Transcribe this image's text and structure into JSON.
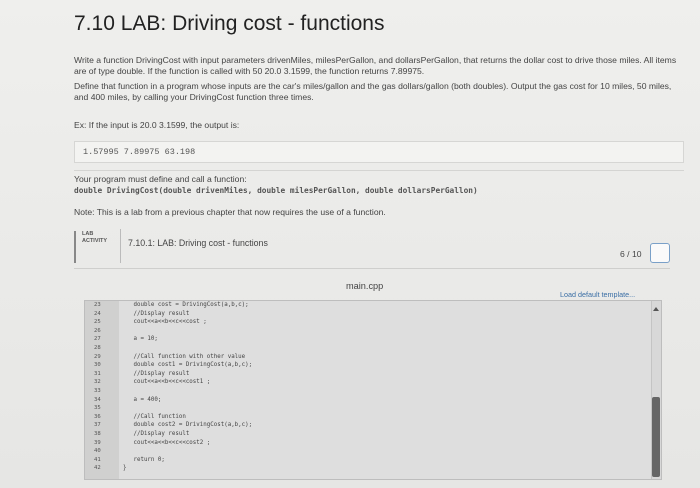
{
  "page": {
    "title": "7.10 LAB: Driving cost - functions",
    "paragraphs": [
      "Write a function DrivingCost with input parameters drivenMiles, milesPerGallon, and dollarsPerGallon, that returns the dollar cost to drive those miles. All items are of type double. If the function is called with 50 20.0 3.1599, the function returns 7.89975.",
      "Define that function in a program whose inputs are the car's miles/gallon and the gas dollars/gallon (both doubles). Output the gas cost for 10 miles, 50 miles, and 400 miles, by calling your DrivingCost function three times.",
      "Ex: If the input is 20.0 3.1599, the output is:"
    ],
    "example_output": "1.57995 7.89975 63.198",
    "must_define": "Your program must define and call a function:",
    "signature": "double DrivingCost(double drivenMiles, double milesPerGallon, double dollarsPerGallon)",
    "note": "Note: This is a lab from a previous chapter that now requires the use of a function."
  },
  "lab": {
    "badge_line1": "LAB",
    "badge_line2": "ACTIVITY",
    "title": "7.10.1: LAB: Driving cost - functions",
    "score": "6 / 10"
  },
  "editor": {
    "filename": "main.cpp",
    "load_template": "Load default template...",
    "lines": [
      {
        "n": "23",
        "code": "   double cost = DrivingCost(a,b,c);"
      },
      {
        "n": "24",
        "code": "   //Display result"
      },
      {
        "n": "25",
        "code": "   cout<<a<<b<<c<<cost ;"
      },
      {
        "n": "26",
        "code": ""
      },
      {
        "n": "27",
        "code": "   a = 10;"
      },
      {
        "n": "28",
        "code": ""
      },
      {
        "n": "29",
        "code": "   //Call function with other value"
      },
      {
        "n": "30",
        "code": "   double cost1 = DrivingCost(a,b,c);"
      },
      {
        "n": "31",
        "code": "   //Display result"
      },
      {
        "n": "32",
        "code": "   cout<<a<<b<<c<<cost1 ;"
      },
      {
        "n": "33",
        "code": ""
      },
      {
        "n": "34",
        "code": "   a = 400;"
      },
      {
        "n": "35",
        "code": ""
      },
      {
        "n": "36",
        "code": "   //Call function"
      },
      {
        "n": "37",
        "code": "   double cost2 = DrivingCost(a,b,c);"
      },
      {
        "n": "38",
        "code": "   //Display result"
      },
      {
        "n": "39",
        "code": "   cout<<a<<b<<c<<cost2 ;"
      },
      {
        "n": "40",
        "code": ""
      },
      {
        "n": "41",
        "code": "   return 0;"
      },
      {
        "n": "42",
        "code": "}"
      }
    ]
  }
}
